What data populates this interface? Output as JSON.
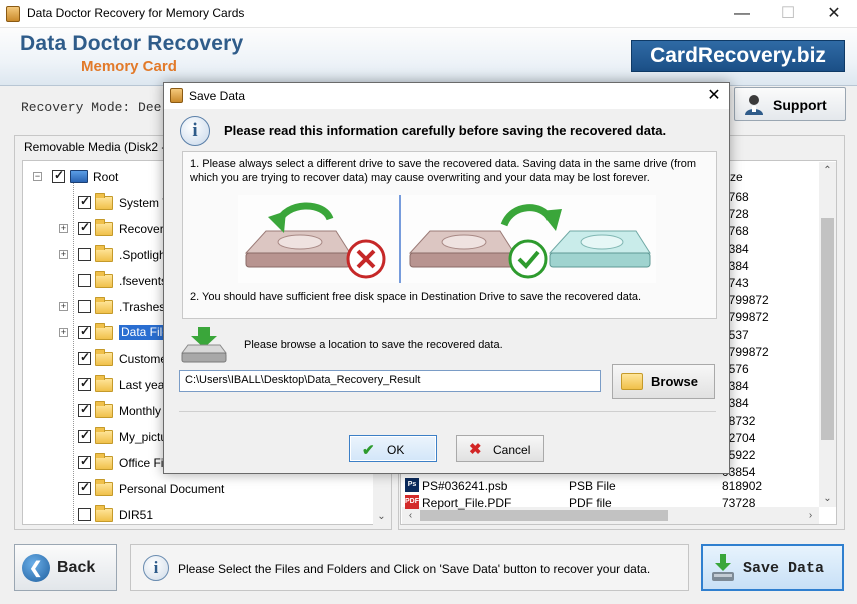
{
  "window": {
    "title": "Data Doctor Recovery for Memory Cards",
    "minimize_glyph": "—",
    "maximize_glyph": "☐",
    "close_glyph": "✕"
  },
  "header": {
    "brand_line1": "Data Doctor Recovery",
    "brand_line2": "Memory Card",
    "site": "CardRecovery.biz"
  },
  "toolbar": {
    "recovery_mode": "Recovery Mode: Dee",
    "support_label": "Support"
  },
  "left_panel": {
    "group_label": "Removable Media (Disk2 - 11",
    "tree": [
      {
        "label": "Root",
        "checked": true,
        "expander": "−",
        "root": true
      },
      {
        "label": "System V",
        "checked": true,
        "expander": ""
      },
      {
        "label": "Recovere",
        "checked": true,
        "expander": "+"
      },
      {
        "label": ".Spotligh",
        "checked": false,
        "expander": "+"
      },
      {
        "label": ".fsevents",
        "checked": false,
        "expander": ""
      },
      {
        "label": ".Trashes",
        "checked": false,
        "expander": "+"
      },
      {
        "label": "Data Files",
        "checked": true,
        "expander": "+",
        "selected": true
      },
      {
        "label": "Customer",
        "checked": true,
        "expander": ""
      },
      {
        "label": "Last year",
        "checked": true,
        "expander": ""
      },
      {
        "label": "Monthly I",
        "checked": true,
        "expander": ""
      },
      {
        "label": "My_pictur",
        "checked": true,
        "expander": ""
      },
      {
        "label": "Office File",
        "checked": true,
        "expander": ""
      },
      {
        "label": "Personal Document",
        "checked": true,
        "expander": ""
      },
      {
        "label": "DIR51",
        "checked": false,
        "expander": ""
      }
    ],
    "scroll_down_glyph": "⌄"
  },
  "right_panel": {
    "size_header": "ze",
    "sizes": [
      "2768",
      "3728",
      "2768",
      "5384",
      "5384",
      "4743",
      "0799872",
      "0799872",
      "1537",
      "0799872",
      "4576",
      "5384",
      "5384",
      "98732",
      "12704",
      "35922",
      "03854"
    ],
    "rows": [
      {
        "icon": "Ps",
        "icon_color": "#0b2a5c",
        "name": "PS#036241.psb",
        "type": "PSB File",
        "size": "818902"
      },
      {
        "icon": "PDF",
        "icon_color": "#d32b2b",
        "name": "Report_File.PDF",
        "type": "PDF file",
        "size": "73728"
      }
    ],
    "scroll_up_glyph": "⌃",
    "scroll_down_glyph": "⌄",
    "scroll_left_glyph": "‹",
    "scroll_right_glyph": "›"
  },
  "bottom": {
    "back_label": "Back",
    "info_text": "Please Select the Files and Folders and Click on 'Save Data' button to recover your data.",
    "save_label": "Save Data",
    "info_glyph": "i"
  },
  "dialog": {
    "title": "Save Data",
    "close_glyph": "✕",
    "info_glyph": "i",
    "heading": "Please read this information carefully before saving the recovered data.",
    "note1": "1. Please always select a different drive to save the recovered data. Saving data in the same drive (from which you are trying to recover data) may cause overwriting and your data may be lost forever.",
    "note2": "2. You should have sufficient free disk space in Destination Drive to save the recovered data.",
    "browse_prompt": "Please browse a location to save the recovered data.",
    "path_value": "C:\\Users\\IBALL\\Desktop\\Data_Recovery_Result",
    "browse_label": "Browse",
    "ok_label": "OK",
    "cancel_label": "Cancel",
    "ok_glyph": "✔",
    "cancel_glyph": "✖"
  },
  "colors": {
    "brand_blue": "#2f5c8a",
    "brand_orange": "#e27a2a",
    "selection": "#2a6ed1"
  }
}
